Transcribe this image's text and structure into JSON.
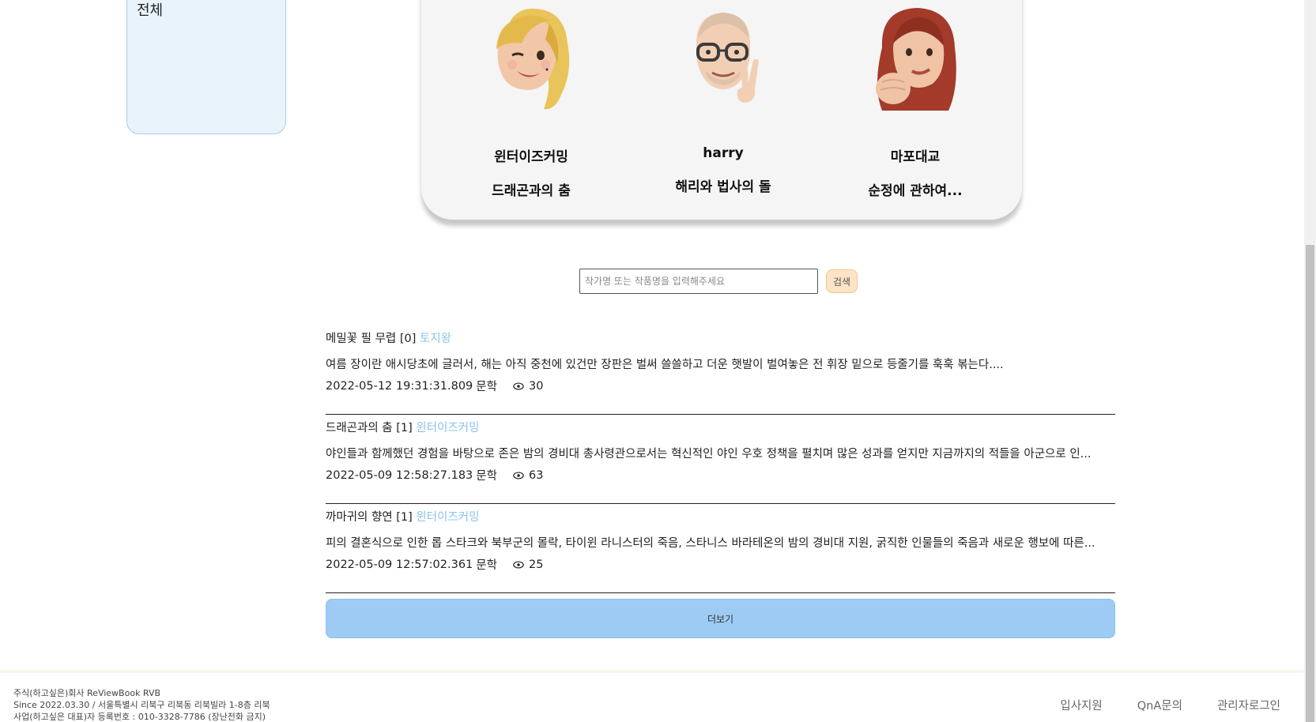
{
  "sidebar": {
    "label": "전체"
  },
  "authors": [
    {
      "name": "윈터이즈커밍",
      "title": "드래곤과의 춤",
      "icon": "blonde-woman-winking-memoji-icon"
    },
    {
      "name": "harry",
      "title": "해리와 법사의 돌",
      "icon": "bald-man-glasses-peace-memoji-icon"
    },
    {
      "name": "마포대교",
      "title": "순정에 관하여...",
      "icon": "red-hair-woman-fist-memoji-icon"
    }
  ],
  "search": {
    "placeholder": "작가명 또는 작품명을 입력해주세요",
    "button_label": "검색"
  },
  "reviews": [
    {
      "title": "메밀꽃 필 무렵 [0]",
      "author": "토지왕",
      "body": "여름 장이란 애시당초에 글러서, 해는 아직 중천에 있건만 장판은 벌써 쓸쓸하고 더운 햇발이 벌여놓은 전 휘장 밑으로 등줄기를 훅훅 볶는다....",
      "date": "2022-05-12 19:31:31.809",
      "category": "문학",
      "views": "30"
    },
    {
      "title": "드래곤과의 춤 [1]",
      "author": "윈터이즈커밍",
      "body": "야인들과 함께했던 경험을 바탕으로 존은 밤의 경비대 총사령관으로서는 혁신적인 야인 우호 정책을 펼치며 많은 성과를 얻지만 지금까지의 적들을 아군으로 인...",
      "date": "2022-05-09 12:58:27.183",
      "category": "문학",
      "views": "63"
    },
    {
      "title": "까마귀의 향연 [1]",
      "author": "윈터이즈커밍",
      "body": "피의 결혼식으로 인한 롭 스타크와 북부군의 몰락, 타이윈 라니스터의 죽음, 스타니스 바라테온의 밤의 경비대 지원, 굵직한 인물들의 죽음과 새로운 행보에 따른...",
      "date": "2022-05-09 12:57:02.361",
      "category": "문학",
      "views": "25"
    }
  ],
  "more_button": "더보기",
  "footer": {
    "line1": "주식(하고싶은)회사 ReViewBook RVB",
    "line2": "Since 2022.03.30 / 서울특별시 리북구 리북동 리북빌라 1-8층 리북",
    "line3": "사업(하고싶은 대표)자 등록번호 : 010-3328-7786 (장난전화 금지)",
    "links": [
      "입사지원",
      "QnA문의",
      "관리자로그인"
    ]
  },
  "colors": {
    "accent_blue": "#9dcbf3",
    "author_link": "#8cc3ea",
    "search_button": "#fde4c6",
    "sidebar_bg": "#e8f3fc"
  }
}
